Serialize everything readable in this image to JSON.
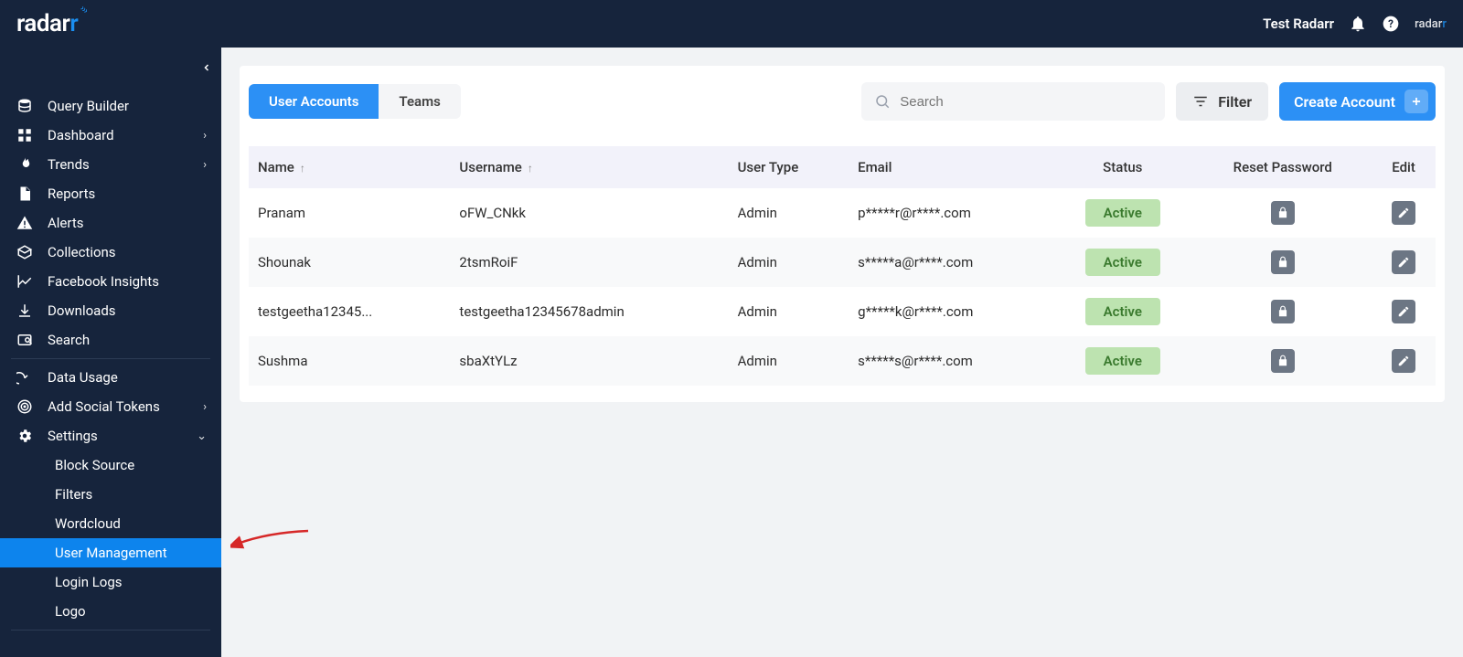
{
  "topbar": {
    "brand": "radarr",
    "user_label": "Test Radarr"
  },
  "sidebar": {
    "items": [
      {
        "icon": "db",
        "label": "Query Builder",
        "chev": false
      },
      {
        "icon": "grid",
        "label": "Dashboard",
        "chev": true
      },
      {
        "icon": "fire",
        "label": "Trends",
        "chev": true
      },
      {
        "icon": "doc",
        "label": "Reports",
        "chev": false
      },
      {
        "icon": "alert",
        "label": "Alerts",
        "chev": false
      },
      {
        "icon": "box",
        "label": "Collections",
        "chev": false
      },
      {
        "icon": "chart",
        "label": "Facebook Insights",
        "chev": false
      },
      {
        "icon": "download",
        "label": "Downloads",
        "chev": false
      },
      {
        "icon": "search",
        "label": "Search",
        "chev": false
      }
    ],
    "items2": [
      {
        "icon": "gauge",
        "label": "Data Usage",
        "chev": false
      },
      {
        "icon": "target",
        "label": "Add Social Tokens",
        "chev": true
      },
      {
        "icon": "gear",
        "label": "Settings",
        "chev": "down"
      }
    ],
    "settings_sub": [
      {
        "label": "Block Source",
        "active": false
      },
      {
        "label": "Filters",
        "active": false
      },
      {
        "label": "Wordcloud",
        "active": false
      },
      {
        "label": "User Management",
        "active": true
      },
      {
        "label": "Login Logs",
        "active": false
      },
      {
        "label": "Logo",
        "active": false
      }
    ]
  },
  "controls": {
    "tab_user_accounts": "User Accounts",
    "tab_teams": "Teams",
    "search_placeholder": "Search",
    "filter_label": "Filter",
    "create_label": "Create Account"
  },
  "table": {
    "headers": {
      "name": "Name",
      "username": "Username",
      "user_type": "User Type",
      "email": "Email",
      "status": "Status",
      "reset_password": "Reset Password",
      "edit": "Edit"
    },
    "rows": [
      {
        "name": "Pranam",
        "username": "oFW_CNkk",
        "user_type": "Admin",
        "email": "p*****r@r****.com",
        "status": "Active"
      },
      {
        "name": "Shounak",
        "username": "2tsmRoiF",
        "user_type": "Admin",
        "email": "s*****a@r****.com",
        "status": "Active"
      },
      {
        "name": "testgeetha12345...",
        "username": "testgeetha12345678admin",
        "user_type": "Admin",
        "email": "g*****k@r****.com",
        "status": "Active"
      },
      {
        "name": "Sushma",
        "username": "sbaXtYLz",
        "user_type": "Admin",
        "email": "s*****s@r****.com",
        "status": "Active"
      }
    ]
  }
}
